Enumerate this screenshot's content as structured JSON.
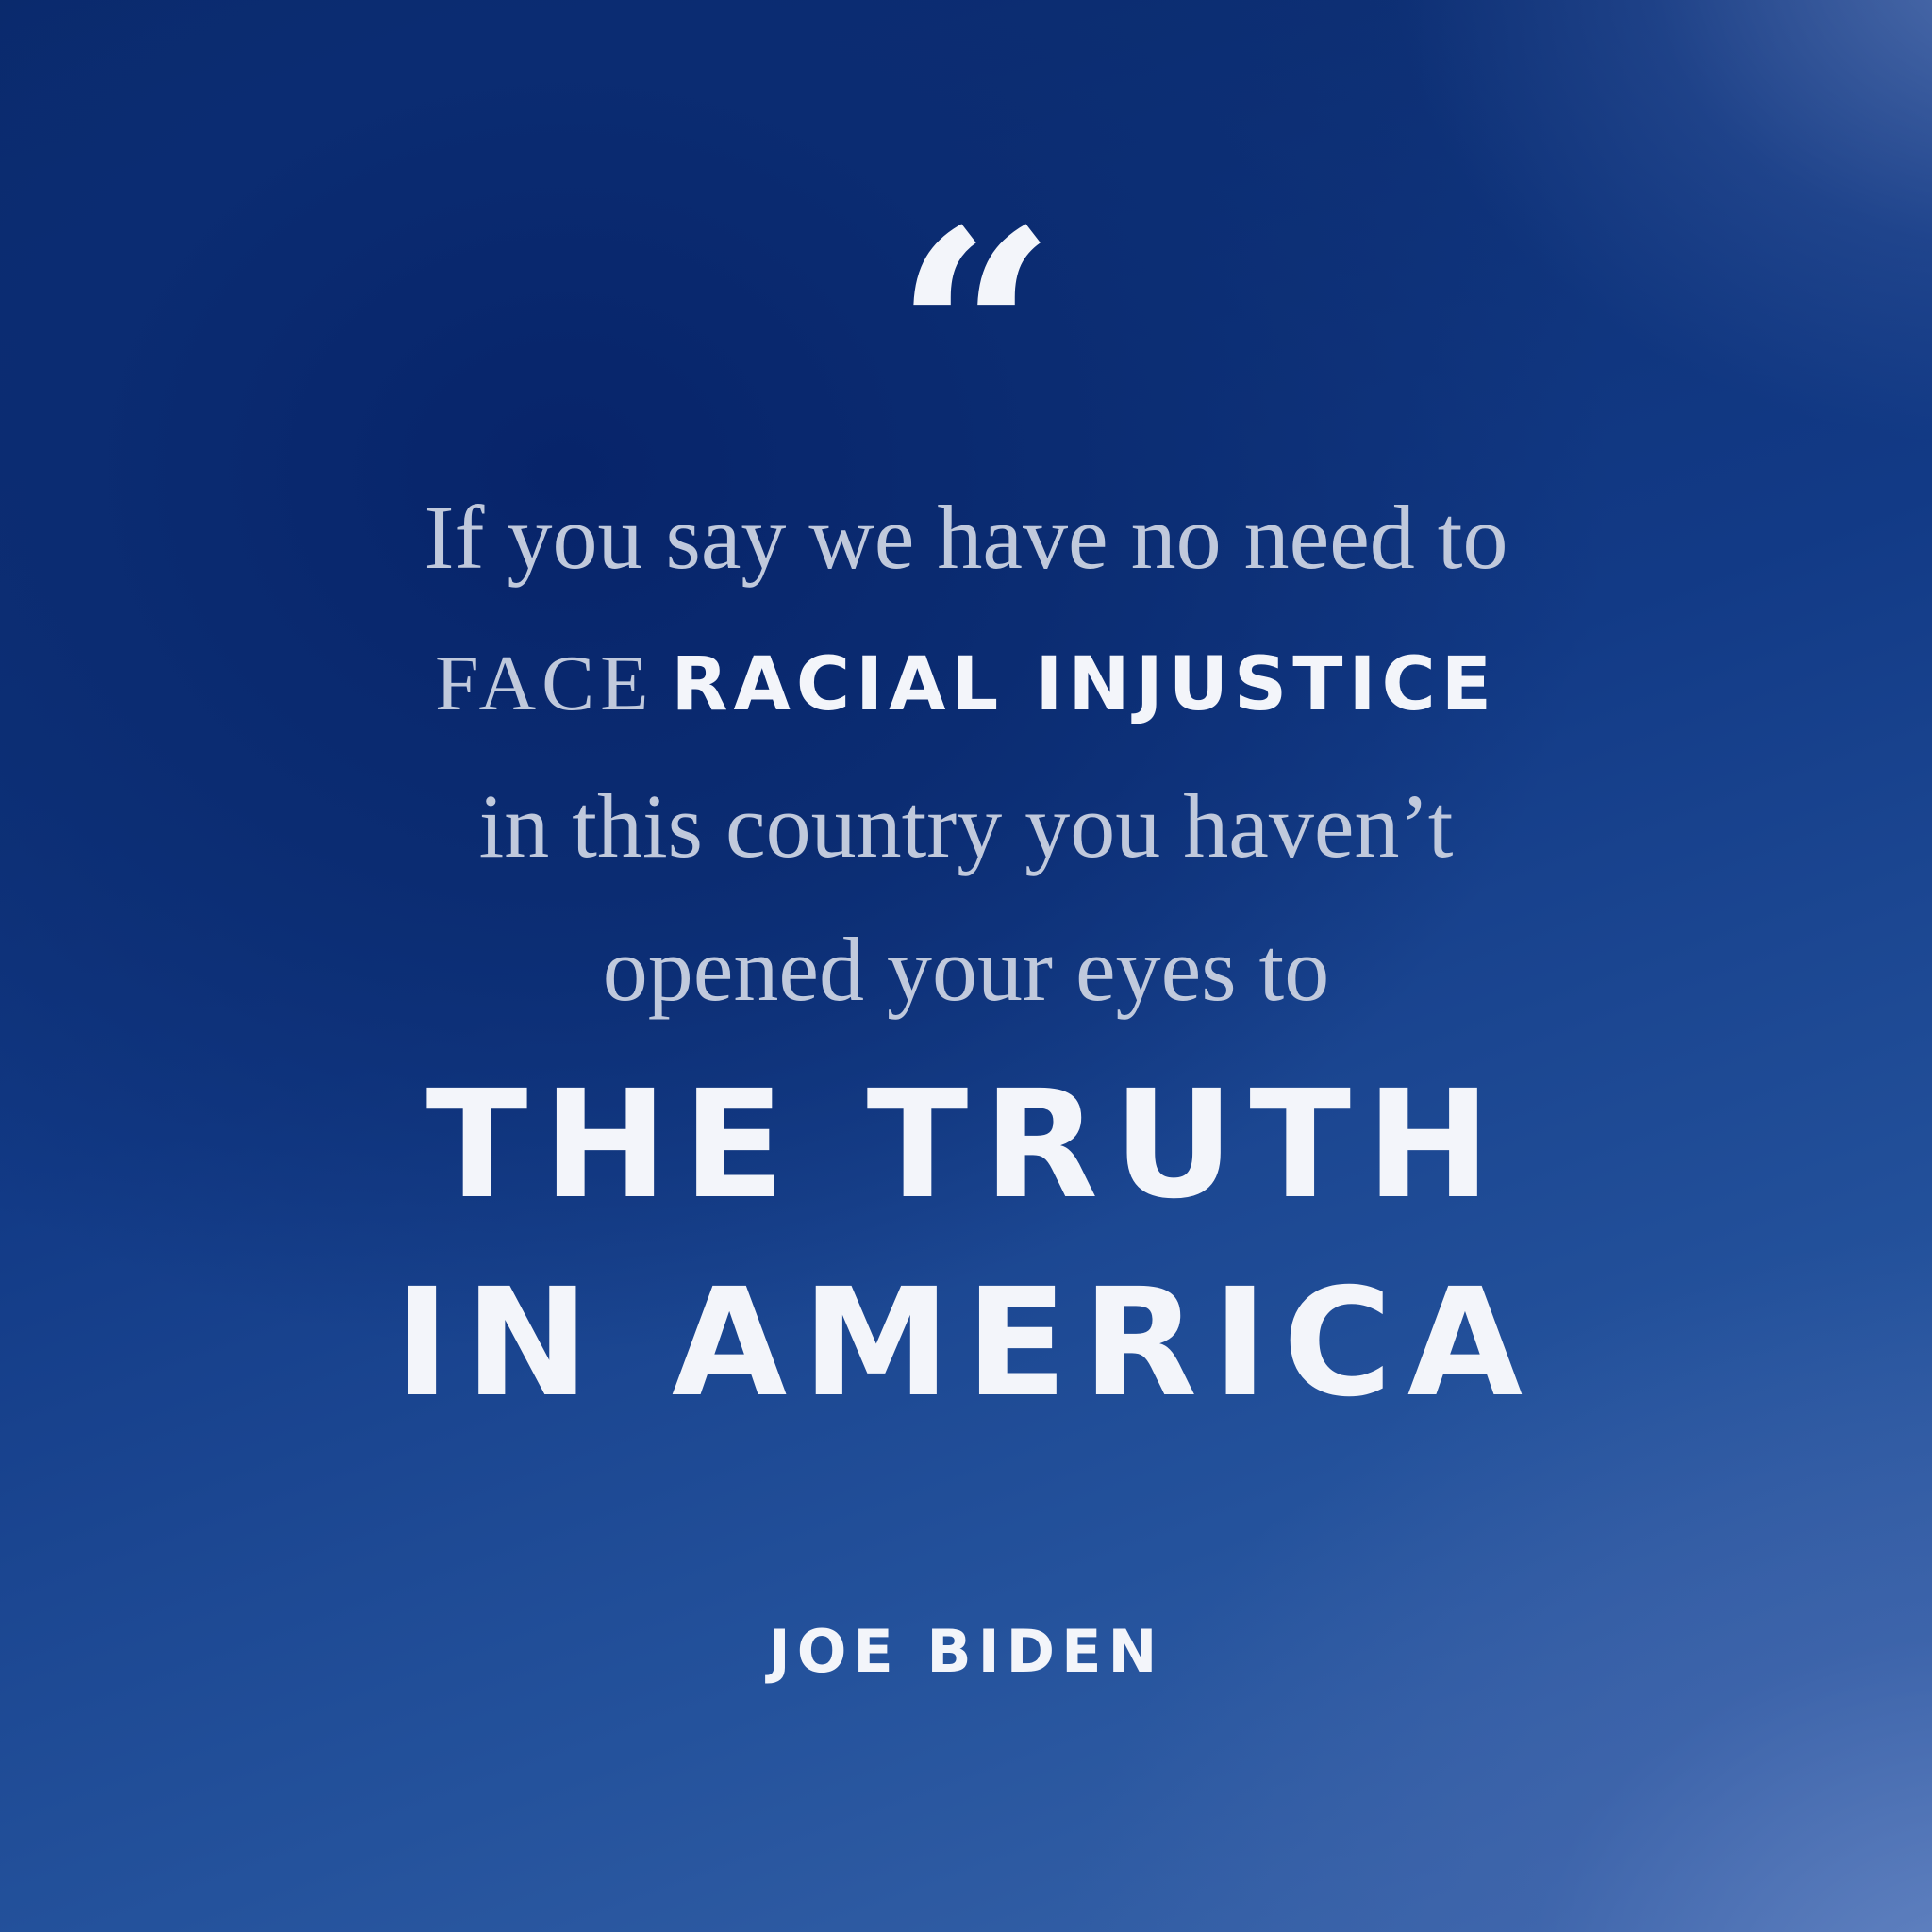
{
  "quote": {
    "open_mark": "“",
    "line1": "If you say we have no need to",
    "line2_lead": "FACE",
    "line2_emphasis": "RACIAL INJUSTICE",
    "line3": "in this country you haven’t",
    "line4": "opened your eyes to",
    "headline_line1": "THE TRUTH",
    "headline_line2": "IN AMERICA"
  },
  "attribution": {
    "author": "JOE BIDEN"
  },
  "colors": {
    "background_dark": "#0a2868",
    "background_light": "#5f7fc0",
    "serif_text": "#c0c9dc",
    "emphasis_text": "#f3f5fa"
  }
}
